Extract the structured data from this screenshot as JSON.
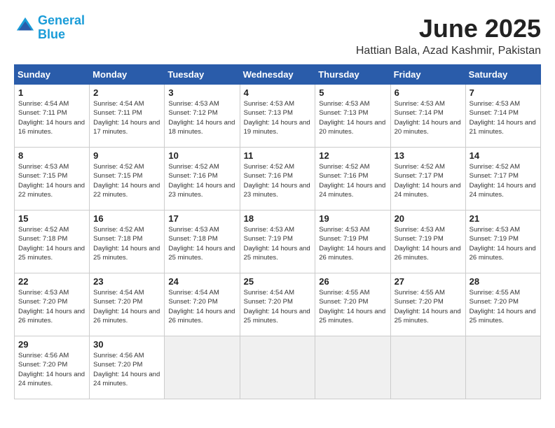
{
  "header": {
    "logo_line1": "General",
    "logo_line2": "Blue",
    "month_title": "June 2025",
    "location": "Hattian Bala, Azad Kashmir, Pakistan"
  },
  "weekdays": [
    "Sunday",
    "Monday",
    "Tuesday",
    "Wednesday",
    "Thursday",
    "Friday",
    "Saturday"
  ],
  "weeks": [
    [
      {
        "day": "1",
        "sunrise": "4:54 AM",
        "sunset": "7:11 PM",
        "daylight": "14 hours and 16 minutes."
      },
      {
        "day": "2",
        "sunrise": "4:54 AM",
        "sunset": "7:11 PM",
        "daylight": "14 hours and 17 minutes."
      },
      {
        "day": "3",
        "sunrise": "4:53 AM",
        "sunset": "7:12 PM",
        "daylight": "14 hours and 18 minutes."
      },
      {
        "day": "4",
        "sunrise": "4:53 AM",
        "sunset": "7:13 PM",
        "daylight": "14 hours and 19 minutes."
      },
      {
        "day": "5",
        "sunrise": "4:53 AM",
        "sunset": "7:13 PM",
        "daylight": "14 hours and 20 minutes."
      },
      {
        "day": "6",
        "sunrise": "4:53 AM",
        "sunset": "7:14 PM",
        "daylight": "14 hours and 20 minutes."
      },
      {
        "day": "7",
        "sunrise": "4:53 AM",
        "sunset": "7:14 PM",
        "daylight": "14 hours and 21 minutes."
      }
    ],
    [
      {
        "day": "8",
        "sunrise": "4:53 AM",
        "sunset": "7:15 PM",
        "daylight": "14 hours and 22 minutes."
      },
      {
        "day": "9",
        "sunrise": "4:52 AM",
        "sunset": "7:15 PM",
        "daylight": "14 hours and 22 minutes."
      },
      {
        "day": "10",
        "sunrise": "4:52 AM",
        "sunset": "7:16 PM",
        "daylight": "14 hours and 23 minutes."
      },
      {
        "day": "11",
        "sunrise": "4:52 AM",
        "sunset": "7:16 PM",
        "daylight": "14 hours and 23 minutes."
      },
      {
        "day": "12",
        "sunrise": "4:52 AM",
        "sunset": "7:16 PM",
        "daylight": "14 hours and 24 minutes."
      },
      {
        "day": "13",
        "sunrise": "4:52 AM",
        "sunset": "7:17 PM",
        "daylight": "14 hours and 24 minutes."
      },
      {
        "day": "14",
        "sunrise": "4:52 AM",
        "sunset": "7:17 PM",
        "daylight": "14 hours and 24 minutes."
      }
    ],
    [
      {
        "day": "15",
        "sunrise": "4:52 AM",
        "sunset": "7:18 PM",
        "daylight": "14 hours and 25 minutes."
      },
      {
        "day": "16",
        "sunrise": "4:52 AM",
        "sunset": "7:18 PM",
        "daylight": "14 hours and 25 minutes."
      },
      {
        "day": "17",
        "sunrise": "4:53 AM",
        "sunset": "7:18 PM",
        "daylight": "14 hours and 25 minutes."
      },
      {
        "day": "18",
        "sunrise": "4:53 AM",
        "sunset": "7:19 PM",
        "daylight": "14 hours and 25 minutes."
      },
      {
        "day": "19",
        "sunrise": "4:53 AM",
        "sunset": "7:19 PM",
        "daylight": "14 hours and 26 minutes."
      },
      {
        "day": "20",
        "sunrise": "4:53 AM",
        "sunset": "7:19 PM",
        "daylight": "14 hours and 26 minutes."
      },
      {
        "day": "21",
        "sunrise": "4:53 AM",
        "sunset": "7:19 PM",
        "daylight": "14 hours and 26 minutes."
      }
    ],
    [
      {
        "day": "22",
        "sunrise": "4:53 AM",
        "sunset": "7:20 PM",
        "daylight": "14 hours and 26 minutes."
      },
      {
        "day": "23",
        "sunrise": "4:54 AM",
        "sunset": "7:20 PM",
        "daylight": "14 hours and 26 minutes."
      },
      {
        "day": "24",
        "sunrise": "4:54 AM",
        "sunset": "7:20 PM",
        "daylight": "14 hours and 26 minutes."
      },
      {
        "day": "25",
        "sunrise": "4:54 AM",
        "sunset": "7:20 PM",
        "daylight": "14 hours and 25 minutes."
      },
      {
        "day": "26",
        "sunrise": "4:55 AM",
        "sunset": "7:20 PM",
        "daylight": "14 hours and 25 minutes."
      },
      {
        "day": "27",
        "sunrise": "4:55 AM",
        "sunset": "7:20 PM",
        "daylight": "14 hours and 25 minutes."
      },
      {
        "day": "28",
        "sunrise": "4:55 AM",
        "sunset": "7:20 PM",
        "daylight": "14 hours and 25 minutes."
      }
    ],
    [
      {
        "day": "29",
        "sunrise": "4:56 AM",
        "sunset": "7:20 PM",
        "daylight": "14 hours and 24 minutes."
      },
      {
        "day": "30",
        "sunrise": "4:56 AM",
        "sunset": "7:20 PM",
        "daylight": "14 hours and 24 minutes."
      },
      null,
      null,
      null,
      null,
      null
    ]
  ]
}
